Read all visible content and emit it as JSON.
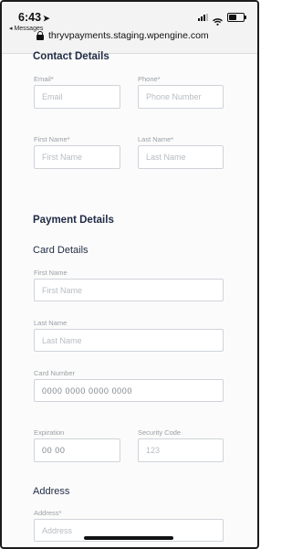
{
  "status": {
    "time": "6:43",
    "back_label": "◂ Messages"
  },
  "browser": {
    "url": "thryvpayments.staging.wpengine.com"
  },
  "contact": {
    "heading": "Contact Details",
    "email_label": "Email*",
    "email_placeholder": "Email",
    "phone_label": "Phone*",
    "phone_placeholder": "Phone Number",
    "first_label": "First Name*",
    "first_placeholder": "First Name",
    "last_label": "Last Name*",
    "last_placeholder": "Last Name"
  },
  "payment": {
    "heading": "Payment Details",
    "card_heading": "Card Details",
    "first_label": "First Name",
    "first_placeholder": "First Name",
    "last_label": "Last Name",
    "last_placeholder": "Last Name",
    "card_label": "Card Number",
    "card_placeholder": "0000  0000  0000  0000",
    "exp_label": "Expiration",
    "exp_placeholder": "00 00",
    "cvc_label": "Security Code",
    "cvc_placeholder": "123"
  },
  "address": {
    "heading": "Address",
    "address_label": "Address*",
    "address_placeholder": "Address"
  }
}
